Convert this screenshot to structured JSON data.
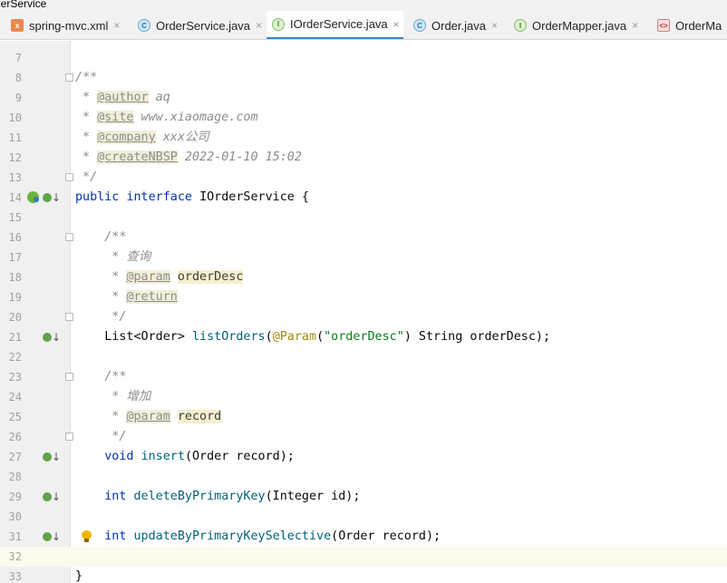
{
  "window": {
    "title_fragment": "lerService"
  },
  "tabs": [
    {
      "label": "spring-mvc.xml",
      "icon": "xml-file-icon",
      "closable": true,
      "active": false
    },
    {
      "label": "OrderService.java",
      "icon": "class-file-icon",
      "closable": true,
      "active": false
    },
    {
      "label": "IOrderService.java",
      "icon": "interface-file-icon",
      "closable": true,
      "active": true
    },
    {
      "label": "Order.java",
      "icon": "class-file-icon",
      "closable": true,
      "active": false
    },
    {
      "label": "OrderMapper.java",
      "icon": "interface-file-icon",
      "closable": true,
      "active": false
    },
    {
      "label": "OrderMa",
      "icon": "mapper-xml-icon",
      "closable": false,
      "active": false
    }
  ],
  "tab_letters": {
    "class": "C",
    "interface": "I",
    "xml": "x",
    "mapper": "<>"
  },
  "editor": {
    "close_glyph": "×",
    "lines": [
      {
        "num": "7",
        "segments": []
      },
      {
        "num": "8",
        "fold": true,
        "segments": [
          {
            "t": "/**",
            "c": "cmt"
          }
        ]
      },
      {
        "num": "9",
        "segments": [
          {
            "t": " * ",
            "c": "cmt"
          },
          {
            "t": "@author",
            "c": "dtag"
          },
          {
            "t": " aq",
            "c": "cmt"
          }
        ]
      },
      {
        "num": "10",
        "segments": [
          {
            "t": " * ",
            "c": "cmt"
          },
          {
            "t": "@site",
            "c": "dtag"
          },
          {
            "t": " www.xiaomage.com",
            "c": "cmt"
          }
        ]
      },
      {
        "num": "11",
        "segments": [
          {
            "t": " * ",
            "c": "cmt"
          },
          {
            "t": "@company",
            "c": "dtag"
          },
          {
            "t": " xxx公司",
            "c": "cmt"
          }
        ]
      },
      {
        "num": "12",
        "segments": [
          {
            "t": " * ",
            "c": "cmt"
          },
          {
            "t": "@createNBSP",
            "c": "dtag"
          },
          {
            "t": " 2022-01-10 15:02",
            "c": "cmt"
          }
        ]
      },
      {
        "num": "13",
        "fold": true,
        "segments": [
          {
            "t": " */",
            "c": "cmt"
          }
        ]
      },
      {
        "num": "14",
        "spring": true,
        "impl": true,
        "segments": [
          {
            "t": "public ",
            "c": "kw"
          },
          {
            "t": "interface ",
            "c": "kw"
          },
          {
            "t": "IOrderService {",
            "c": ""
          }
        ]
      },
      {
        "num": "15",
        "segments": []
      },
      {
        "num": "16",
        "fold": true,
        "segments": [
          {
            "t": "    /**",
            "c": "cmt"
          }
        ]
      },
      {
        "num": "17",
        "segments": [
          {
            "t": "     * 查询",
            "c": "cmt"
          }
        ]
      },
      {
        "num": "18",
        "segments": [
          {
            "t": "     * ",
            "c": "cmt"
          },
          {
            "t": "@param",
            "c": "dtag"
          },
          {
            "t": " ",
            "c": "cmt"
          },
          {
            "t": "orderDesc",
            "c": "dparam"
          }
        ]
      },
      {
        "num": "19",
        "segments": [
          {
            "t": "     * ",
            "c": "cmt"
          },
          {
            "t": "@return",
            "c": "dtag"
          }
        ]
      },
      {
        "num": "20",
        "fold": true,
        "segments": [
          {
            "t": "     */",
            "c": "cmt"
          }
        ]
      },
      {
        "num": "21",
        "impl": true,
        "segments": [
          {
            "t": "    List<Order> ",
            "c": ""
          },
          {
            "t": "listOrders",
            "c": "fn"
          },
          {
            "t": "(",
            "c": ""
          },
          {
            "t": "@Param",
            "c": "ann"
          },
          {
            "t": "(",
            "c": ""
          },
          {
            "t": "\"orderDesc\"",
            "c": "str"
          },
          {
            "t": ") String orderDesc);",
            "c": ""
          }
        ]
      },
      {
        "num": "22",
        "segments": []
      },
      {
        "num": "23",
        "fold": true,
        "segments": [
          {
            "t": "    /**",
            "c": "cmt"
          }
        ]
      },
      {
        "num": "24",
        "segments": [
          {
            "t": "     * 增加",
            "c": "cmt"
          }
        ]
      },
      {
        "num": "25",
        "segments": [
          {
            "t": "     * ",
            "c": "cmt"
          },
          {
            "t": "@param",
            "c": "dtag"
          },
          {
            "t": " ",
            "c": "cmt"
          },
          {
            "t": "record",
            "c": "dparam"
          }
        ]
      },
      {
        "num": "26",
        "fold": true,
        "segments": [
          {
            "t": "     */",
            "c": "cmt"
          }
        ]
      },
      {
        "num": "27",
        "impl": true,
        "segments": [
          {
            "t": "    ",
            "c": ""
          },
          {
            "t": "void ",
            "c": "kw"
          },
          {
            "t": "insert",
            "c": "fn"
          },
          {
            "t": "(Order record);",
            "c": ""
          }
        ]
      },
      {
        "num": "28",
        "segments": []
      },
      {
        "num": "29",
        "impl": true,
        "segments": [
          {
            "t": "    ",
            "c": ""
          },
          {
            "t": "int ",
            "c": "kw"
          },
          {
            "t": "deleteByPrimaryKey",
            "c": "fn"
          },
          {
            "t": "(Integer id);",
            "c": ""
          }
        ]
      },
      {
        "num": "30",
        "segments": []
      },
      {
        "num": "31",
        "impl": true,
        "bulb": true,
        "segments": [
          {
            "t": "    ",
            "c": ""
          },
          {
            "t": "int ",
            "c": "kw"
          },
          {
            "t": "updateByPrimaryKeySelective",
            "c": "fn"
          },
          {
            "t": "(Order record);",
            "c": ""
          }
        ]
      },
      {
        "num": "32",
        "current": true,
        "segments": []
      },
      {
        "num": "33",
        "segments": [
          {
            "t": "}",
            "c": ""
          }
        ]
      }
    ]
  }
}
